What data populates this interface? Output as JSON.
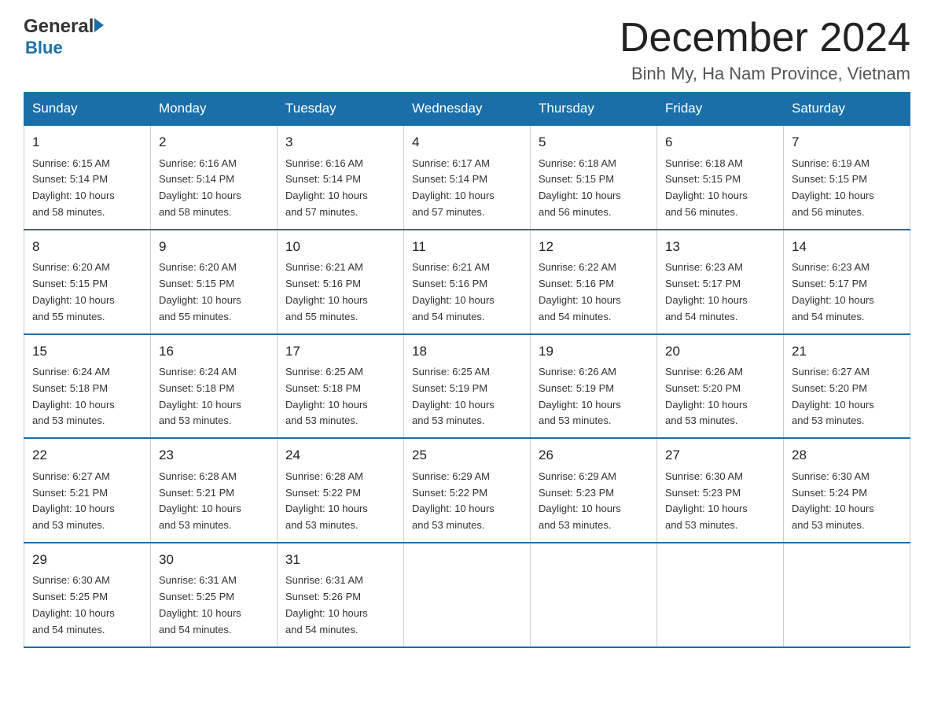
{
  "header": {
    "logo_general": "General",
    "logo_blue": "Blue",
    "month_title": "December 2024",
    "location": "Binh My, Ha Nam Province, Vietnam"
  },
  "weekdays": [
    "Sunday",
    "Monday",
    "Tuesday",
    "Wednesday",
    "Thursday",
    "Friday",
    "Saturday"
  ],
  "weeks": [
    [
      {
        "day": "1",
        "sunrise": "6:15 AM",
        "sunset": "5:14 PM",
        "daylight": "10 hours and 58 minutes."
      },
      {
        "day": "2",
        "sunrise": "6:16 AM",
        "sunset": "5:14 PM",
        "daylight": "10 hours and 58 minutes."
      },
      {
        "day": "3",
        "sunrise": "6:16 AM",
        "sunset": "5:14 PM",
        "daylight": "10 hours and 57 minutes."
      },
      {
        "day": "4",
        "sunrise": "6:17 AM",
        "sunset": "5:14 PM",
        "daylight": "10 hours and 57 minutes."
      },
      {
        "day": "5",
        "sunrise": "6:18 AM",
        "sunset": "5:15 PM",
        "daylight": "10 hours and 56 minutes."
      },
      {
        "day": "6",
        "sunrise": "6:18 AM",
        "sunset": "5:15 PM",
        "daylight": "10 hours and 56 minutes."
      },
      {
        "day": "7",
        "sunrise": "6:19 AM",
        "sunset": "5:15 PM",
        "daylight": "10 hours and 56 minutes."
      }
    ],
    [
      {
        "day": "8",
        "sunrise": "6:20 AM",
        "sunset": "5:15 PM",
        "daylight": "10 hours and 55 minutes."
      },
      {
        "day": "9",
        "sunrise": "6:20 AM",
        "sunset": "5:15 PM",
        "daylight": "10 hours and 55 minutes."
      },
      {
        "day": "10",
        "sunrise": "6:21 AM",
        "sunset": "5:16 PM",
        "daylight": "10 hours and 55 minutes."
      },
      {
        "day": "11",
        "sunrise": "6:21 AM",
        "sunset": "5:16 PM",
        "daylight": "10 hours and 54 minutes."
      },
      {
        "day": "12",
        "sunrise": "6:22 AM",
        "sunset": "5:16 PM",
        "daylight": "10 hours and 54 minutes."
      },
      {
        "day": "13",
        "sunrise": "6:23 AM",
        "sunset": "5:17 PM",
        "daylight": "10 hours and 54 minutes."
      },
      {
        "day": "14",
        "sunrise": "6:23 AM",
        "sunset": "5:17 PM",
        "daylight": "10 hours and 54 minutes."
      }
    ],
    [
      {
        "day": "15",
        "sunrise": "6:24 AM",
        "sunset": "5:18 PM",
        "daylight": "10 hours and 53 minutes."
      },
      {
        "day": "16",
        "sunrise": "6:24 AM",
        "sunset": "5:18 PM",
        "daylight": "10 hours and 53 minutes."
      },
      {
        "day": "17",
        "sunrise": "6:25 AM",
        "sunset": "5:18 PM",
        "daylight": "10 hours and 53 minutes."
      },
      {
        "day": "18",
        "sunrise": "6:25 AM",
        "sunset": "5:19 PM",
        "daylight": "10 hours and 53 minutes."
      },
      {
        "day": "19",
        "sunrise": "6:26 AM",
        "sunset": "5:19 PM",
        "daylight": "10 hours and 53 minutes."
      },
      {
        "day": "20",
        "sunrise": "6:26 AM",
        "sunset": "5:20 PM",
        "daylight": "10 hours and 53 minutes."
      },
      {
        "day": "21",
        "sunrise": "6:27 AM",
        "sunset": "5:20 PM",
        "daylight": "10 hours and 53 minutes."
      }
    ],
    [
      {
        "day": "22",
        "sunrise": "6:27 AM",
        "sunset": "5:21 PM",
        "daylight": "10 hours and 53 minutes."
      },
      {
        "day": "23",
        "sunrise": "6:28 AM",
        "sunset": "5:21 PM",
        "daylight": "10 hours and 53 minutes."
      },
      {
        "day": "24",
        "sunrise": "6:28 AM",
        "sunset": "5:22 PM",
        "daylight": "10 hours and 53 minutes."
      },
      {
        "day": "25",
        "sunrise": "6:29 AM",
        "sunset": "5:22 PM",
        "daylight": "10 hours and 53 minutes."
      },
      {
        "day": "26",
        "sunrise": "6:29 AM",
        "sunset": "5:23 PM",
        "daylight": "10 hours and 53 minutes."
      },
      {
        "day": "27",
        "sunrise": "6:30 AM",
        "sunset": "5:23 PM",
        "daylight": "10 hours and 53 minutes."
      },
      {
        "day": "28",
        "sunrise": "6:30 AM",
        "sunset": "5:24 PM",
        "daylight": "10 hours and 53 minutes."
      }
    ],
    [
      {
        "day": "29",
        "sunrise": "6:30 AM",
        "sunset": "5:25 PM",
        "daylight": "10 hours and 54 minutes."
      },
      {
        "day": "30",
        "sunrise": "6:31 AM",
        "sunset": "5:25 PM",
        "daylight": "10 hours and 54 minutes."
      },
      {
        "day": "31",
        "sunrise": "6:31 AM",
        "sunset": "5:26 PM",
        "daylight": "10 hours and 54 minutes."
      },
      null,
      null,
      null,
      null
    ]
  ],
  "labels": {
    "sunrise": "Sunrise:",
    "sunset": "Sunset:",
    "daylight": "Daylight:"
  }
}
